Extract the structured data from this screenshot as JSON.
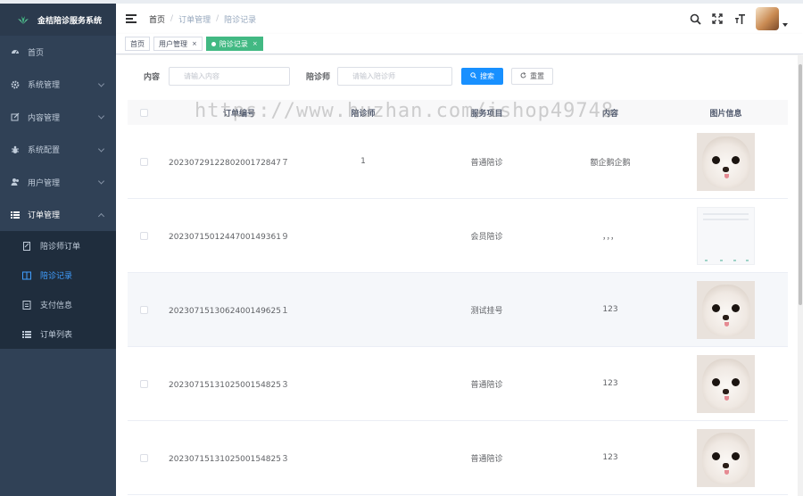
{
  "app": {
    "title": "金桔陪诊服务系统"
  },
  "sidebar": {
    "items": [
      {
        "label": "首页",
        "icon": "dashboard-icon"
      },
      {
        "label": "系统管理",
        "icon": "gear-icon"
      },
      {
        "label": "内容管理",
        "icon": "edit-icon"
      },
      {
        "label": "系统配置",
        "icon": "bug-icon"
      },
      {
        "label": "用户管理",
        "icon": "users-icon"
      },
      {
        "label": "订单管理",
        "icon": "list-icon"
      }
    ],
    "order_sub": [
      {
        "label": "陪诊师订单",
        "icon": "document-icon"
      },
      {
        "label": "陪诊记录",
        "icon": "book-icon"
      },
      {
        "label": "支付信息",
        "icon": "receipt-icon"
      },
      {
        "label": "订单列表",
        "icon": "list-icon"
      }
    ]
  },
  "breadcrumb": [
    "首页",
    "订单管理",
    "陪诊记录"
  ],
  "tags": [
    {
      "label": "首页"
    },
    {
      "label": "用户管理",
      "close": "×"
    },
    {
      "label": "陪诊记录",
      "close": "×"
    }
  ],
  "search": {
    "content_label": "内容",
    "content_placeholder": "请输入内容",
    "doctor_label": "陪诊师",
    "doctor_placeholder": "请输入陪诊师",
    "search_btn": "搜索",
    "reset_btn": "重置"
  },
  "table": {
    "columns": [
      "订单编号",
      "陪诊师",
      "服务项目",
      "内容",
      "图片信息"
    ],
    "rows": [
      {
        "order_no": "2023072912280200172847７",
        "doctor": "1",
        "item": "普通陪诊",
        "content": "额企鹅企鹅",
        "image": "dog"
      },
      {
        "order_no": "2023071501244700149361９",
        "doctor": "",
        "item": "会员陪诊",
        "content": "，，，",
        "image": "screenshot"
      },
      {
        "order_no": "2023071513062400149625１",
        "doctor": "",
        "item": "测试挂号",
        "content": "123",
        "image": "dog"
      },
      {
        "order_no": "2023071513102500154825３",
        "doctor": "",
        "item": "普通陪诊",
        "content": "123",
        "image": "dog"
      },
      {
        "order_no": "2023071513102500154825３",
        "doctor": "",
        "item": "普通陪诊",
        "content": "123",
        "image": "dog"
      }
    ]
  },
  "watermark": "https://www.huzhan.com/ishop49748",
  "colors": {
    "sidebar_bg": "#304156",
    "accent": "#1890ff",
    "active_tag": "#42b983",
    "active_menu": "#409eff"
  }
}
